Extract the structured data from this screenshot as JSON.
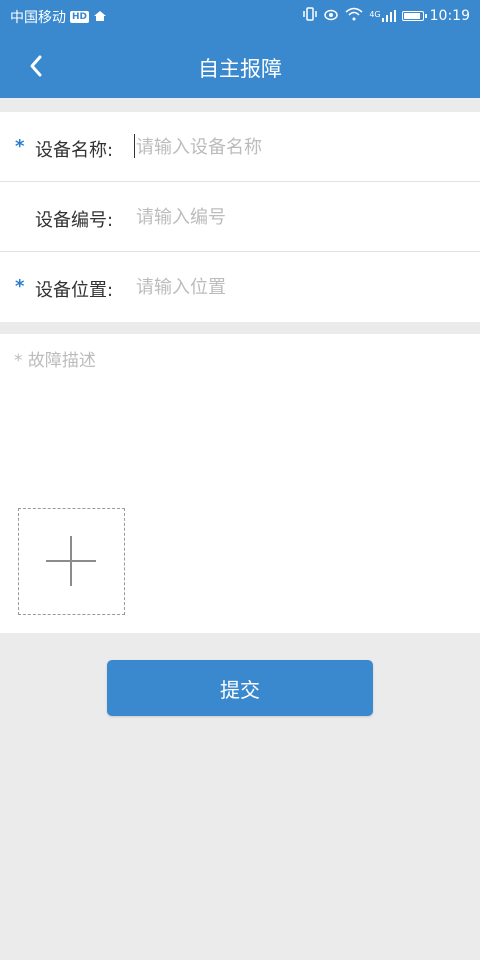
{
  "statusbar": {
    "carrier": "中国移动",
    "hd_badge": "HD",
    "network": "4G",
    "time": "10:19",
    "icons": [
      "vibrate-icon",
      "eye-icon",
      "wifi-icon",
      "signal-icon",
      "battery-icon"
    ]
  },
  "header": {
    "title": "自主报障",
    "back_icon": "chevron-left-icon"
  },
  "form": {
    "required_mark": "*",
    "device_name": {
      "label": "设备名称:",
      "placeholder": "请输入设备名称",
      "value": "",
      "required": true
    },
    "device_number": {
      "label": "设备编号:",
      "placeholder": "请输入编号",
      "value": "",
      "required": false
    },
    "device_location": {
      "label": "设备位置:",
      "placeholder": "请输入位置",
      "value": "",
      "required": true
    }
  },
  "description": {
    "placeholder": "* 故障描述",
    "value": "",
    "upload_icon": "plus-icon"
  },
  "submit": {
    "label": "提交"
  },
  "colors": {
    "primary": "#3a89cf",
    "required": "#2a7cd0",
    "background": "#ebebeb",
    "placeholder": "#bcbcbc"
  }
}
